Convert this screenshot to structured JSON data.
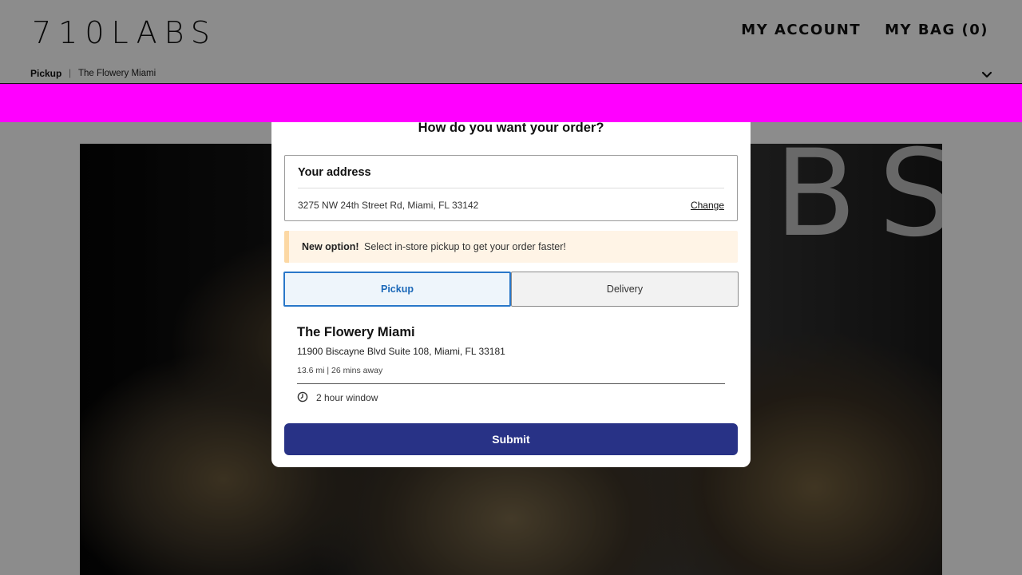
{
  "header": {
    "logo": "710LABS",
    "nav": {
      "account": "MY ACCOUNT",
      "bag": "MY BAG (0)"
    }
  },
  "fulfillment_bar": {
    "mode": "Pickup",
    "separator": "|",
    "store": "The Flowery Miami"
  },
  "hero": {
    "glass_text": "BS"
  },
  "modal": {
    "title": "How do you want your order?",
    "address": {
      "heading": "Your address",
      "value": "3275 NW 24th Street Rd, Miami, FL 33142",
      "change_label": "Change"
    },
    "notice": {
      "strong": "New option!",
      "text": "Select in-store pickup to get your order faster!"
    },
    "tabs": [
      {
        "label": "Pickup",
        "selected": true
      },
      {
        "label": "Delivery",
        "selected": false
      }
    ],
    "store": {
      "name": "The Flowery Miami",
      "address": "11900 Biscayne Blvd Suite 108, Miami, FL 33181",
      "distance": "13.6 mi | 26 mins away",
      "window": "2 hour window"
    },
    "submit_label": "Submit"
  },
  "colors": {
    "accent_blue": "#2977c9",
    "submit_navy": "#283286",
    "notice_bg": "#fff4e6",
    "banner_magenta": "#ff00ff"
  },
  "icons": {
    "chevron": "chevron-down-icon",
    "clock": "clock-icon"
  }
}
